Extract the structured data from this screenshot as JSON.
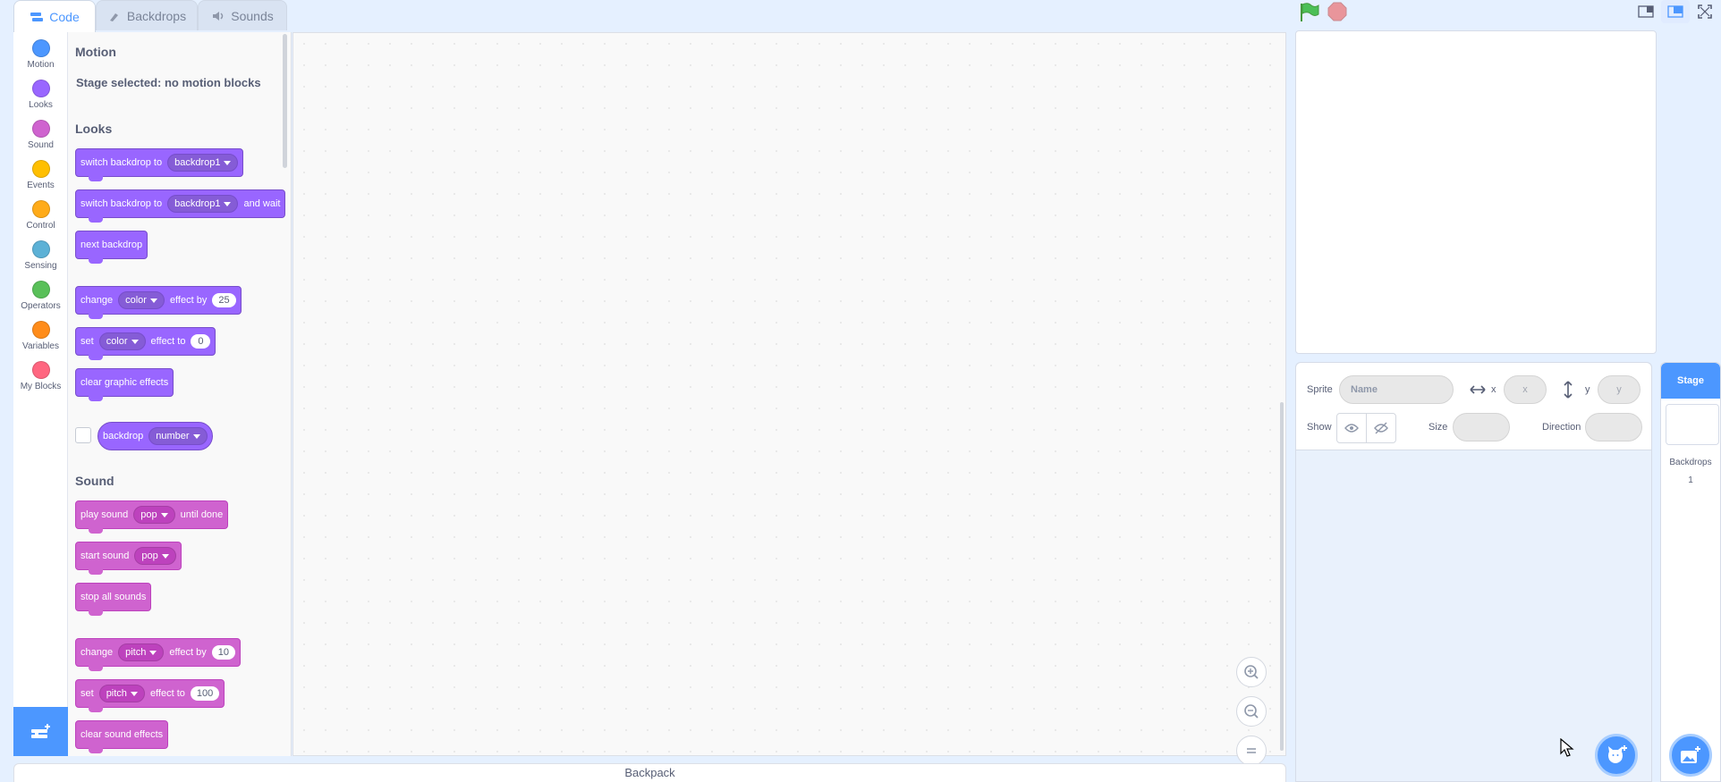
{
  "tabs": [
    {
      "label": "Code",
      "icon": "code-icon"
    },
    {
      "label": "Backdrops",
      "icon": "brush-icon"
    },
    {
      "label": "Sounds",
      "icon": "speaker-icon"
    }
  ],
  "categories": [
    {
      "label": "Motion",
      "color": "#4c97ff"
    },
    {
      "label": "Looks",
      "color": "#9966ff"
    },
    {
      "label": "Sound",
      "color": "#cf63cf"
    },
    {
      "label": "Events",
      "color": "#ffbf00"
    },
    {
      "label": "Control",
      "color": "#ffab19"
    },
    {
      "label": "Sensing",
      "color": "#5cb1d6"
    },
    {
      "label": "Operators",
      "color": "#59c059"
    },
    {
      "label": "Variables",
      "color": "#ff8c1a"
    },
    {
      "label": "My Blocks",
      "color": "#ff6680"
    }
  ],
  "palette": {
    "motion_title": "Motion",
    "motion_note": "Stage selected: no motion blocks",
    "looks_title": "Looks",
    "sound_title": "Sound",
    "looks": {
      "switch_backdrop": "switch backdrop to",
      "backdrop1": "backdrop1",
      "and_wait": "and wait",
      "next_backdrop": "next backdrop",
      "change": "change",
      "color": "color",
      "effect_by": "effect by",
      "val_25": "25",
      "set": "set",
      "effect_to": "effect to",
      "val_0": "0",
      "clear_graphic": "clear graphic effects",
      "backdrop": "backdrop",
      "number": "number"
    },
    "sound": {
      "play_sound": "play sound",
      "pop": "pop",
      "until_done": "until done",
      "start_sound": "start sound",
      "stop_all": "stop all sounds",
      "change": "change",
      "pitch": "pitch",
      "effect_by": "effect by",
      "val_10": "10",
      "set": "set",
      "effect_to": "effect to",
      "val_100": "100",
      "clear_sound": "clear sound effects"
    }
  },
  "backpack_label": "Backpack",
  "sprite_info": {
    "sprite_label": "Sprite",
    "name_placeholder": "Name",
    "x_label": "x",
    "x_placeholder": "x",
    "y_label": "y",
    "y_placeholder": "y",
    "show_label": "Show",
    "size_label": "Size",
    "direction_label": "Direction"
  },
  "stage_selector": {
    "title": "Stage",
    "backdrops_label": "Backdrops",
    "backdrops_count": "1"
  },
  "colors": {
    "accent": "#4c97ff",
    "looks": "#9966ff",
    "sound": "#cf63cf"
  }
}
